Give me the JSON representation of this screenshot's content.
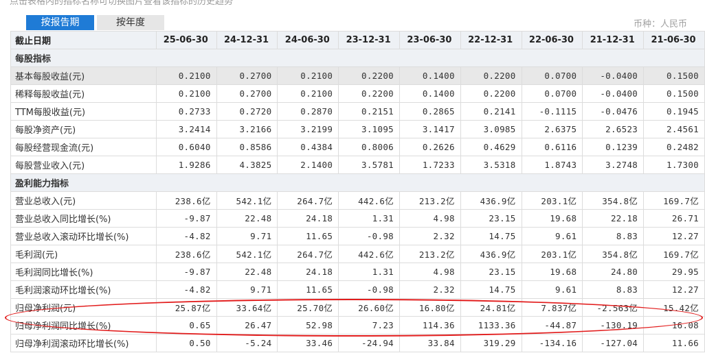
{
  "hint_text": "点击表格内的指标名称可切换图片查看该指标的历史趋势",
  "tabs": {
    "by_report": "按报告期",
    "by_year": "按年度"
  },
  "currency": {
    "label": "币种：",
    "value": "人民币"
  },
  "table": {
    "header_label": "截止日期",
    "periods": [
      "25-06-30",
      "24-12-31",
      "24-06-30",
      "23-12-31",
      "23-06-30",
      "22-12-31",
      "22-06-30",
      "21-12-31",
      "21-06-30"
    ],
    "sections": [
      {
        "title": "每股指标",
        "rows": [
          {
            "label": "基本每股收益(元)",
            "values": [
              "0.2100",
              "0.2700",
              "0.2100",
              "0.2200",
              "0.1400",
              "0.2200",
              "0.0700",
              "-0.0400",
              "0.1500"
            ]
          },
          {
            "label": "稀释每股收益(元)",
            "values": [
              "0.2100",
              "0.2700",
              "0.2100",
              "0.2200",
              "0.1400",
              "0.2200",
              "0.0700",
              "-0.0400",
              "0.1500"
            ]
          },
          {
            "label": "TTM每股收益(元)",
            "values": [
              "0.2733",
              "0.2720",
              "0.2870",
              "0.2151",
              "0.2865",
              "0.2141",
              "-0.1115",
              "-0.0476",
              "0.1945"
            ]
          },
          {
            "label": "每股净资产(元)",
            "values": [
              "3.2414",
              "3.2166",
              "3.2199",
              "3.1095",
              "3.1417",
              "3.0985",
              "2.6375",
              "2.6523",
              "2.4561"
            ]
          },
          {
            "label": "每股经营现金流(元)",
            "values": [
              "0.6040",
              "0.8586",
              "0.4384",
              "0.8006",
              "0.2626",
              "0.4629",
              "0.6116",
              "0.1239",
              "0.2482"
            ]
          },
          {
            "label": "每股营业收入(元)",
            "values": [
              "1.9286",
              "4.3825",
              "2.1400",
              "3.5781",
              "1.7233",
              "3.5318",
              "1.8743",
              "3.2748",
              "1.7300"
            ]
          }
        ]
      },
      {
        "title": "盈利能力指标",
        "rows": [
          {
            "label": "营业总收入(元)",
            "values": [
              "238.6亿",
              "542.1亿",
              "264.7亿",
              "442.6亿",
              "213.2亿",
              "436.9亿",
              "203.1亿",
              "354.8亿",
              "169.7亿"
            ]
          },
          {
            "label": "营业总收入同比增长(%)",
            "values": [
              "-9.87",
              "22.48",
              "24.18",
              "1.31",
              "4.98",
              "23.15",
              "19.68",
              "22.18",
              "26.71"
            ]
          },
          {
            "label": "营业总收入滚动环比增长(%)",
            "values": [
              "-4.82",
              "9.71",
              "11.65",
              "-0.98",
              "2.32",
              "14.75",
              "9.61",
              "8.83",
              "12.27"
            ]
          },
          {
            "label": "毛利润(元)",
            "values": [
              "238.6亿",
              "542.1亿",
              "264.7亿",
              "442.6亿",
              "213.2亿",
              "436.9亿",
              "203.1亿",
              "354.8亿",
              "169.7亿"
            ]
          },
          {
            "label": "毛利润同比增长(%)",
            "values": [
              "-9.87",
              "22.48",
              "24.18",
              "1.31",
              "4.98",
              "23.15",
              "19.68",
              "24.80",
              "29.95"
            ]
          },
          {
            "label": "毛利润滚动环比增长(%)",
            "values": [
              "-4.82",
              "9.71",
              "11.65",
              "-0.98",
              "2.32",
              "14.75",
              "9.61",
              "8.83",
              "12.27"
            ]
          },
          {
            "label": "归母净利润(元)",
            "values": [
              "25.87亿",
              "33.64亿",
              "25.70亿",
              "26.60亿",
              "16.80亿",
              "24.81亿",
              "7.837亿",
              "-2.563亿",
              "15.42亿"
            ]
          },
          {
            "label": "归母净利润同比增长(%)",
            "values": [
              "0.65",
              "26.47",
              "52.98",
              "7.23",
              "114.36",
              "1133.36",
              "-44.87",
              "-130.19",
              "16.08"
            ]
          },
          {
            "label": "归母净利润滚动环比增长(%)",
            "values": [
              "0.50",
              "-5.24",
              "33.46",
              "-24.94",
              "33.84",
              "319.29",
              "-134.16",
              "-127.04",
              "11.66"
            ]
          }
        ]
      }
    ]
  },
  "colors": {
    "tab_active_bg": "#1f7bd6",
    "header_bg": "#eef1f5",
    "highlight_oval": "#e21c1c"
  }
}
